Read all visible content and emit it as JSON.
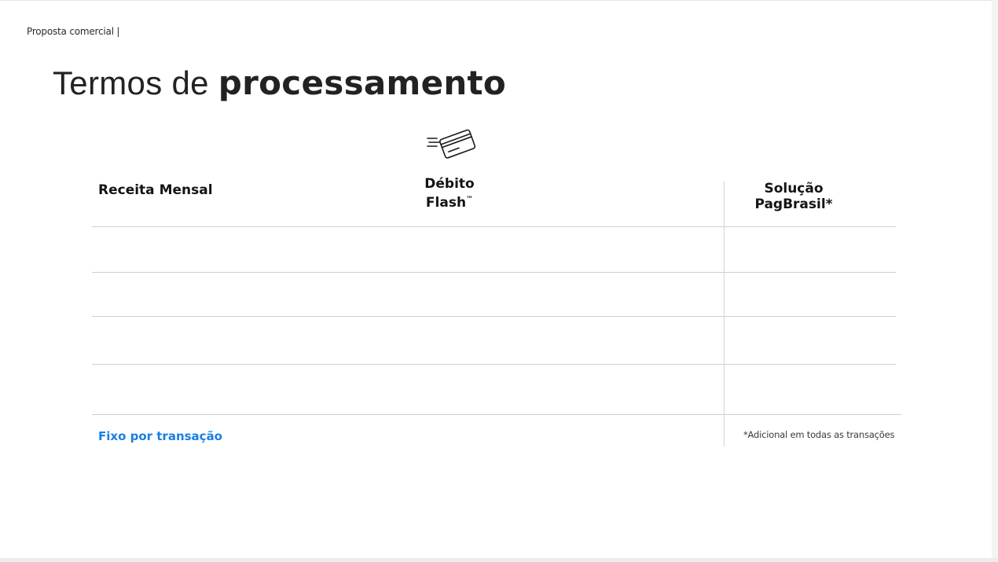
{
  "breadcrumb": "Proposta comercial |",
  "title": {
    "light": "Termos de ",
    "bold": "processamento"
  },
  "icons": {
    "card": "flying-credit-card-icon"
  },
  "table": {
    "headers": {
      "receita": "Receita Mensal",
      "debito_line1": "Débito",
      "debito_line2": "Flash",
      "debito_mark": "™",
      "solucao_line1": "Solução",
      "solucao_line2": "PagBrasil*"
    },
    "rows": [
      {
        "receita": "",
        "debito": "",
        "solucao": ""
      },
      {
        "receita": "",
        "debito": "",
        "solucao": ""
      },
      {
        "receita": "",
        "debito": "",
        "solucao": ""
      },
      {
        "receita": "",
        "debito": "",
        "solucao": ""
      }
    ],
    "footer_label": "Fixo por transação",
    "footnote": "*Adicional em todas as transações"
  },
  "colors": {
    "accent": "#1a7fe0",
    "text": "#1a1a1a",
    "rule": "#cfcfcf"
  }
}
